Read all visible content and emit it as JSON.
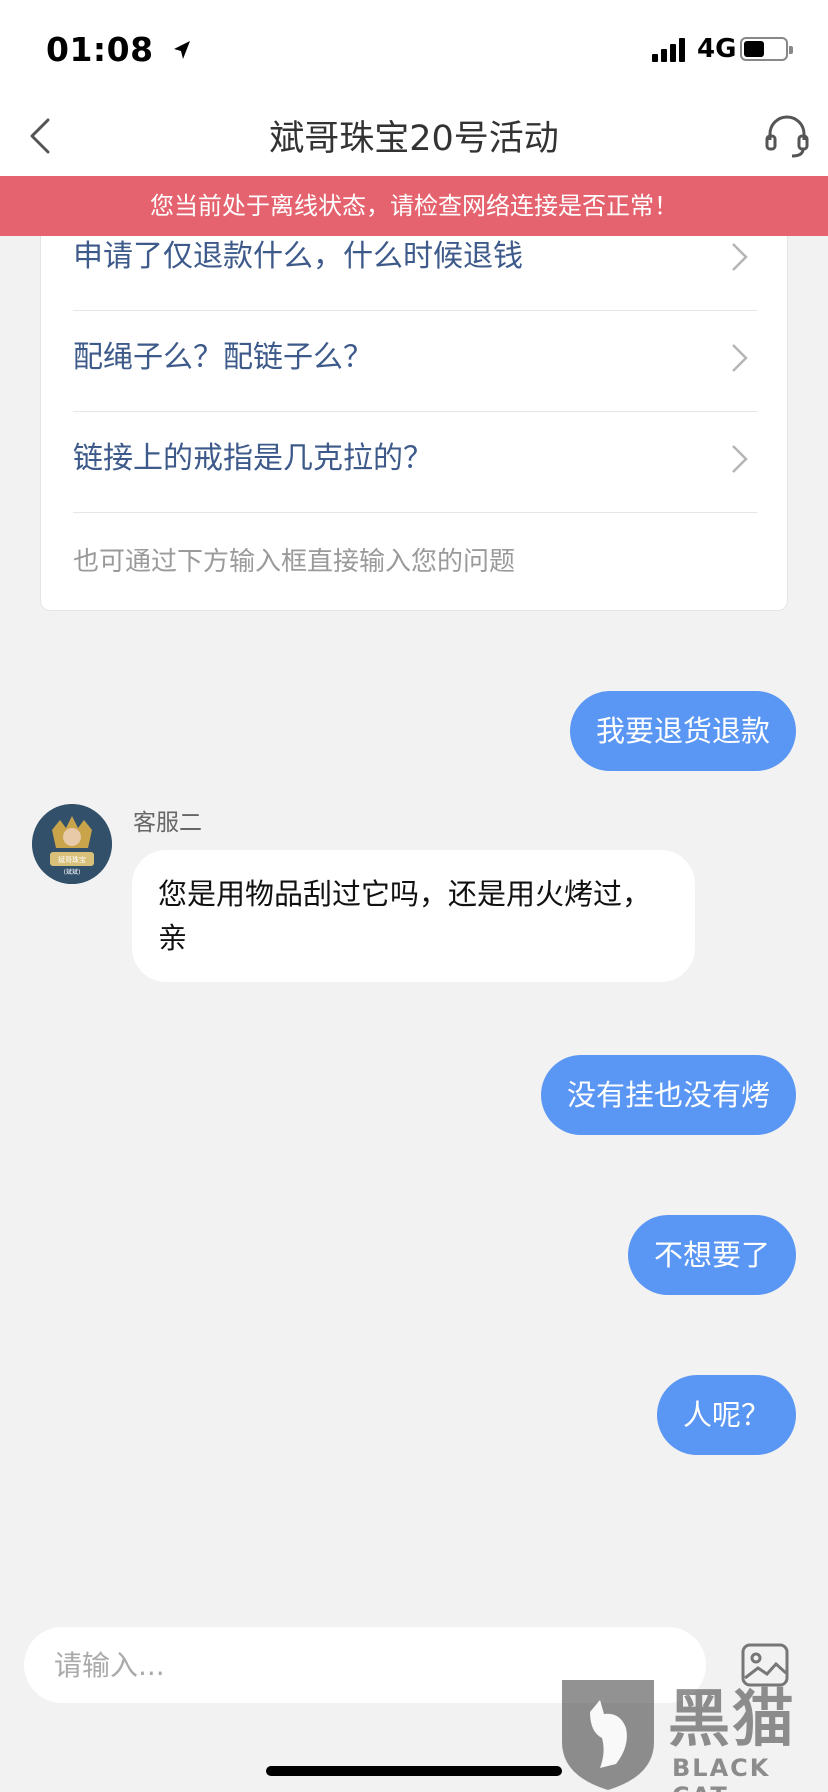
{
  "status_bar": {
    "time": "01:08",
    "network": "4G"
  },
  "nav": {
    "title": "斌哥珠宝20号活动"
  },
  "offline_banner": "您当前处于离线状态，请检查网络连接是否正常！",
  "faq": {
    "items": [
      {
        "label": "申请了仅退款什么，什么时候退钱"
      },
      {
        "label": "配绳子么？配链子么？"
      },
      {
        "label": "链接上的戒指是几克拉的？"
      }
    ],
    "hint": "也可通过下方输入框直接输入您的问题"
  },
  "messages": {
    "out_1": "我要退货退款",
    "agent_name": "客服二",
    "in_1": "您是用物品刮过它吗，还是用火烤过，亲",
    "out_2": "没有挂也没有烤",
    "out_3": "不想要了",
    "out_4": "人呢？"
  },
  "avatar": {
    "line1": "斌哥珠宝",
    "line2": "(斌斌)"
  },
  "input": {
    "placeholder": "请输入..."
  },
  "watermark": {
    "cn": "黑猫",
    "en": "BLACK CAT"
  },
  "colors": {
    "accent": "#5a96f3",
    "banner": "#e5636f",
    "faq_text": "#3d5a8a"
  }
}
